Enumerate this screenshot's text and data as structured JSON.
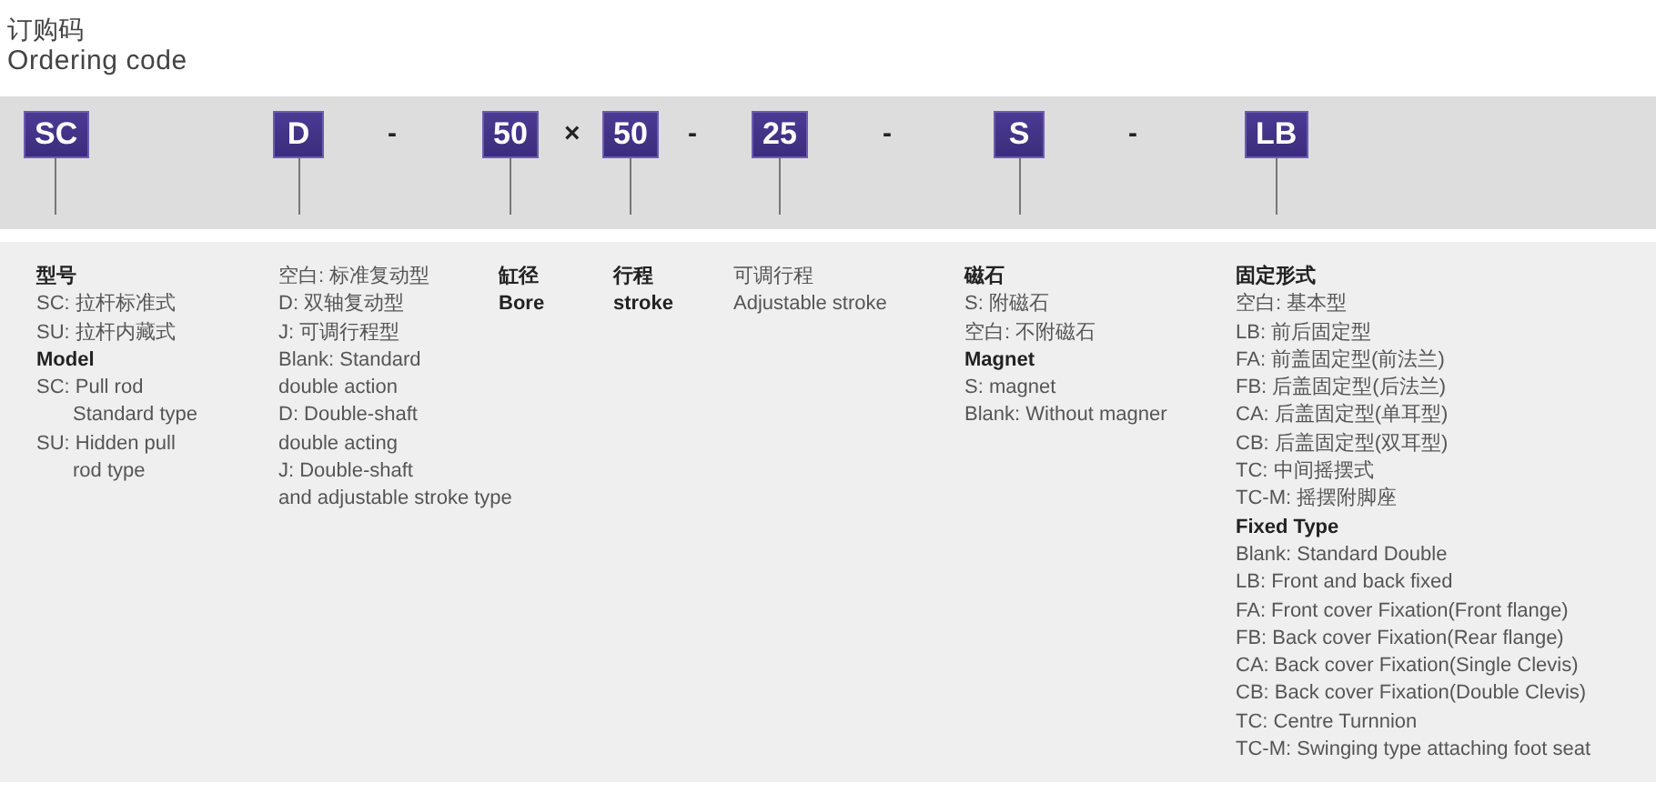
{
  "title": {
    "chinese": "订购码",
    "english": "Ordering code"
  },
  "code": [
    {
      "kind": "segment",
      "text": "SC"
    },
    {
      "kind": "segment",
      "text": "D"
    },
    {
      "kind": "separator",
      "text": "-"
    },
    {
      "kind": "segment",
      "text": "50"
    },
    {
      "kind": "separator",
      "text": "×"
    },
    {
      "kind": "segment",
      "text": "50"
    },
    {
      "kind": "separator",
      "text": "-"
    },
    {
      "kind": "segment",
      "text": "25"
    },
    {
      "kind": "separator",
      "text": "-"
    },
    {
      "kind": "segment",
      "text": "S"
    },
    {
      "kind": "separator",
      "text": "-"
    },
    {
      "kind": "segment",
      "text": "LB"
    }
  ],
  "descriptions": [
    {
      "lines": [
        {
          "kind": "heading",
          "text": "型号"
        },
        {
          "kind": "text",
          "text": "SC: 拉杆标准式"
        },
        {
          "kind": "text",
          "text": "SU: 拉杆内藏式"
        },
        {
          "kind": "heading",
          "text": "Model"
        },
        {
          "kind": "text",
          "text": "SC: Pull rod"
        },
        {
          "kind": "indent",
          "text": "Standard type"
        },
        {
          "kind": "text",
          "text": "SU: Hidden pull"
        },
        {
          "kind": "indent",
          "text": "rod type"
        }
      ]
    },
    {
      "lines": [
        {
          "kind": "text",
          "text": "空白: 标准复动型"
        },
        {
          "kind": "text",
          "text": "D: 双轴复动型"
        },
        {
          "kind": "text",
          "text": "J: 可调行程型"
        },
        {
          "kind": "text",
          "text": "Blank: Standard"
        },
        {
          "kind": "text",
          "text": "double action"
        },
        {
          "kind": "text",
          "text": "D: Double-shaft"
        },
        {
          "kind": "text",
          "text": "double acting"
        },
        {
          "kind": "text",
          "text": "J: Double-shaft"
        },
        {
          "kind": "text",
          "text": "and adjustable stroke type"
        }
      ]
    },
    {
      "lines": [
        {
          "kind": "heading",
          "text": "缸径"
        },
        {
          "kind": "heading",
          "text": "Bore"
        }
      ]
    },
    {
      "lines": [
        {
          "kind": "heading",
          "text": "行程"
        },
        {
          "kind": "heading",
          "text": "stroke"
        }
      ]
    },
    {
      "lines": [
        {
          "kind": "text",
          "text": "可调行程"
        },
        {
          "kind": "text",
          "text": "Adjustable stroke"
        }
      ]
    },
    {
      "lines": [
        {
          "kind": "heading",
          "text": "磁石"
        },
        {
          "kind": "text",
          "text": "S: 附磁石"
        },
        {
          "kind": "text",
          "text": "空白: 不附磁石"
        },
        {
          "kind": "heading",
          "text": "Magnet"
        },
        {
          "kind": "text",
          "text": "S: magnet"
        },
        {
          "kind": "text",
          "text": "Blank: Without magner"
        }
      ]
    },
    {
      "lines": [
        {
          "kind": "heading",
          "text": "固定形式"
        },
        {
          "kind": "text",
          "text": "空白: 基本型"
        },
        {
          "kind": "text",
          "text": "LB: 前后固定型"
        },
        {
          "kind": "text",
          "text": "FA: 前盖固定型(前法兰)"
        },
        {
          "kind": "text",
          "text": "FB: 后盖固定型(后法兰)"
        },
        {
          "kind": "text",
          "text": "CA: 后盖固定型(单耳型)"
        },
        {
          "kind": "text",
          "text": "CB: 后盖固定型(双耳型)"
        },
        {
          "kind": "text",
          "text": "TC: 中间摇摆式"
        },
        {
          "kind": "text",
          "text": "TC-M: 摇摆附脚座"
        },
        {
          "kind": "heading",
          "text": "Fixed Type"
        },
        {
          "kind": "text",
          "text": "Blank: Standard Double"
        },
        {
          "kind": "text",
          "text": "LB: Front and back fixed"
        },
        {
          "kind": "text",
          "text": "FA: Front cover Fixation(Front flange)"
        },
        {
          "kind": "text",
          "text": "FB: Back cover Fixation(Rear flange)"
        },
        {
          "kind": "text",
          "text": "CA: Back cover Fixation(Single Clevis)"
        },
        {
          "kind": "text",
          "text": "CB: Back cover Fixation(Double Clevis)"
        },
        {
          "kind": "text",
          "text": "TC: Centre Turnnion"
        },
        {
          "kind": "text",
          "text": "TC-M: Swinging type attaching foot seat"
        }
      ]
    }
  ]
}
